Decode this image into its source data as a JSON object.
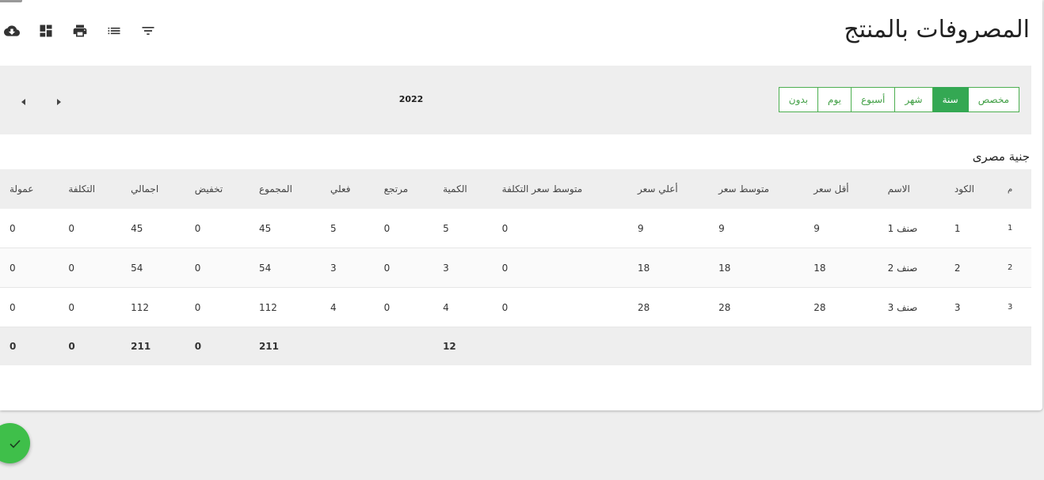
{
  "page": {
    "title": "المصروفات بالمنتج",
    "currency": "جنية مصرى"
  },
  "toolbar": {
    "icons": [
      "cloud-download-icon",
      "dashboard-icon",
      "print-icon",
      "list-icon",
      "filter-icon"
    ]
  },
  "period": {
    "options": [
      "بدون",
      "يوم",
      "أسبوع",
      "شهر",
      "سنة",
      "مخصص"
    ],
    "selected": "سنة",
    "year": "2022"
  },
  "table": {
    "headers": [
      "م",
      "الكود",
      "الاسم",
      "أقل سعر",
      "متوسط سعر",
      "أعلي سعر",
      "متوسط سعر التكلفة",
      "الكمية",
      "مرتجع",
      "فعلي",
      "المجموع",
      "تخفيض",
      "اجمالي",
      "التكلفة",
      "عمولة"
    ],
    "rows": [
      [
        "1",
        "1",
        "صنف 1",
        "9",
        "9",
        "9",
        "0",
        "5",
        "0",
        "5",
        "45",
        "0",
        "45",
        "0",
        "0"
      ],
      [
        "2",
        "2",
        "صنف 2",
        "18",
        "18",
        "18",
        "0",
        "3",
        "0",
        "3",
        "54",
        "0",
        "54",
        "0",
        "0"
      ],
      [
        "3",
        "3",
        "صنف 3",
        "28",
        "28",
        "28",
        "0",
        "4",
        "0",
        "4",
        "112",
        "0",
        "112",
        "0",
        "0"
      ]
    ],
    "totals": [
      "",
      "",
      "",
      "",
      "",
      "",
      "",
      "12",
      "",
      "",
      "211",
      "0",
      "211",
      "0",
      "0"
    ]
  },
  "colors": {
    "accent": "#34a853",
    "header_bg": "#eeeeee"
  }
}
